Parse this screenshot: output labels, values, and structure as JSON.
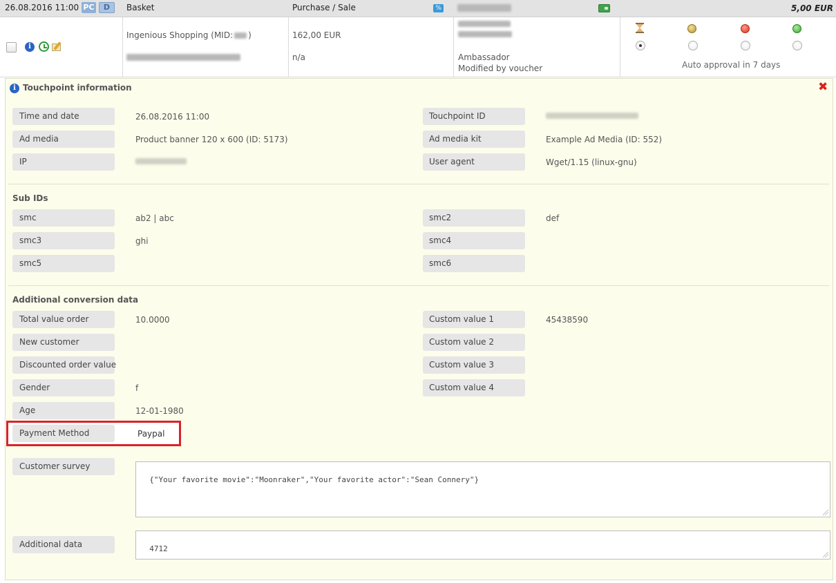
{
  "header": {
    "datetime": "26.08.2016 11:00",
    "badge_pc": "PC",
    "badge_d": "D",
    "type": "Basket",
    "category": "Purchase / Sale",
    "percent_icon": "%",
    "amount": "5,00 EUR"
  },
  "conversion": {
    "program": "Ingenious Shopping (MID:",
    "program_suffix": ")",
    "order_total": "162,00 EUR",
    "order_secondary": "n/a",
    "partner_role": "Ambassador",
    "partner_note": "Modified by voucher",
    "approval_text": "Auto approval in 7 days",
    "status_icons": [
      "hourglass-icon",
      "pending-icon",
      "rejected-icon",
      "approved-icon"
    ]
  },
  "touchpoint": {
    "title": "Touchpoint information",
    "left": [
      {
        "label": "Time and date",
        "value": "26.08.2016 11:00"
      },
      {
        "label": "Ad media",
        "value": "Product banner 120 x 600 (ID: 5173)"
      },
      {
        "label": "IP",
        "value": ""
      }
    ],
    "right": [
      {
        "label": "Touchpoint ID",
        "value": ""
      },
      {
        "label": "Ad media kit",
        "value": "Example Ad Media (ID: 552)"
      },
      {
        "label": "User agent",
        "value": "Wget/1.15 (linux-gnu)"
      }
    ]
  },
  "subids": {
    "title": "Sub IDs",
    "left": [
      {
        "label": "smc",
        "value": "ab2 | abc"
      },
      {
        "label": "smc3",
        "value": "ghi"
      },
      {
        "label": "smc5",
        "value": ""
      }
    ],
    "right": [
      {
        "label": "smc2",
        "value": "def"
      },
      {
        "label": "smc4",
        "value": ""
      },
      {
        "label": "smc6",
        "value": ""
      }
    ]
  },
  "additional": {
    "title": "Additional conversion data",
    "left": [
      {
        "label": "Total value order",
        "value": "10.0000"
      },
      {
        "label": "New customer",
        "value": ""
      },
      {
        "label": "Discounted order value",
        "value": ""
      },
      {
        "label": "Gender",
        "value": "f"
      },
      {
        "label": "Age",
        "value": "12-01-1980"
      },
      {
        "label": "Payment Method",
        "value": "Paypal"
      }
    ],
    "right": [
      {
        "label": "Custom value 1",
        "value": "45438590"
      },
      {
        "label": "Custom value 2",
        "value": ""
      },
      {
        "label": "Custom value 3",
        "value": ""
      },
      {
        "label": "Custom value 4",
        "value": ""
      }
    ],
    "survey_label": "Customer survey",
    "survey_value": "{\"Your favorite movie\":\"Moonraker\",\"Your favorite actor\":\"Sean Connery\"}",
    "extra_label": "Additional data",
    "extra_value": "4712"
  },
  "colors": {
    "panel_bg": "#fdfdec",
    "highlight": "#d8232a",
    "close": "#d8231b",
    "info": "#2a64c5"
  }
}
